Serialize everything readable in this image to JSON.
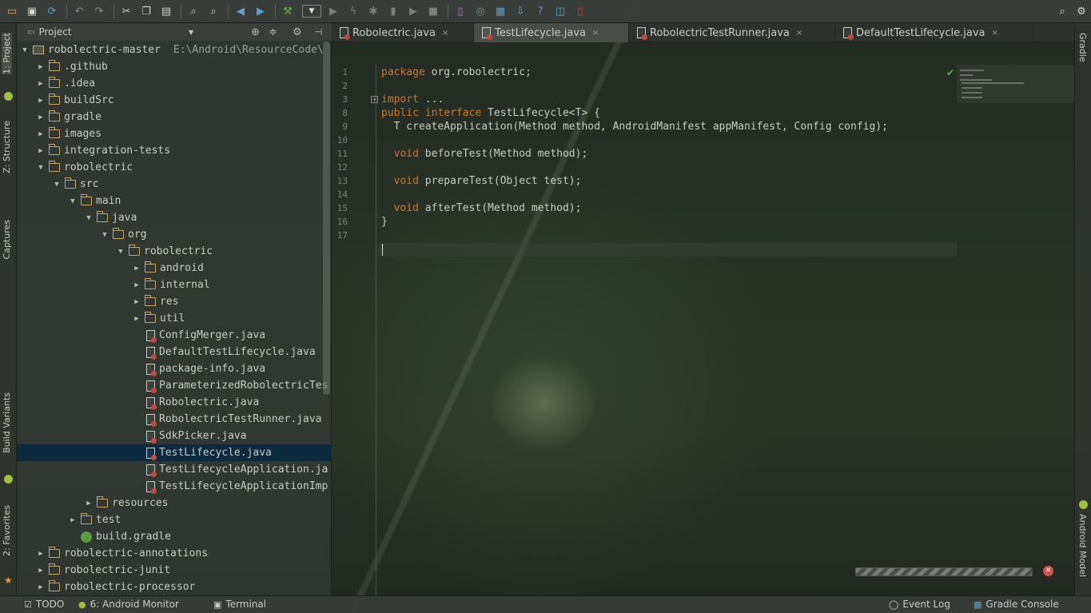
{
  "toolbar": {
    "icons": [
      "open-folder",
      "save",
      "sync",
      "undo",
      "redo",
      "cut",
      "copy",
      "paste",
      "find",
      "find-replace",
      "back",
      "forward",
      "make-project",
      "run-config-dropdown",
      "run",
      "debug",
      "attach-debugger",
      "profile",
      "coverage",
      "stop",
      "avd-manager",
      "sdk-manager",
      "android-device-monitor",
      "project-structure",
      "structure-download",
      "help",
      "translations",
      "device-file"
    ],
    "search_icon": "search-icon"
  },
  "left_stripe": {
    "project": "1: Project",
    "structure": "Z: Structure",
    "captures": "Captures",
    "build_variants": "Build Variants",
    "favorites": "2: Favorites"
  },
  "right_stripe": {
    "gradle": "Gradle",
    "android_model": "Android Model"
  },
  "project_panel": {
    "view_selector": "Project",
    "tree": [
      {
        "label": "robolectric-master",
        "path": "E:\\Android\\ResourceCode\\",
        "type": "module",
        "expanded": true
      },
      {
        "label": ".github",
        "type": "folder"
      },
      {
        "label": ".idea",
        "type": "folder"
      },
      {
        "label": "buildSrc",
        "type": "folder"
      },
      {
        "label": "gradle",
        "type": "folder"
      },
      {
        "label": "images",
        "type": "folder"
      },
      {
        "label": "integration-tests",
        "type": "folder"
      },
      {
        "label": "robolectric",
        "type": "folder",
        "expanded": true
      },
      {
        "label": "src",
        "type": "folder",
        "expanded": true
      },
      {
        "label": "main",
        "type": "folder",
        "expanded": true
      },
      {
        "label": "java",
        "type": "folder",
        "expanded": true
      },
      {
        "label": "org",
        "type": "folder",
        "expanded": true
      },
      {
        "label": "robolectric",
        "type": "folder",
        "expanded": true
      },
      {
        "label": "android",
        "type": "folder"
      },
      {
        "label": "internal",
        "type": "folder"
      },
      {
        "label": "res",
        "type": "folder"
      },
      {
        "label": "util",
        "type": "folder"
      },
      {
        "label": "ConfigMerger.java",
        "type": "java"
      },
      {
        "label": "DefaultTestLifecycle.java",
        "type": "java"
      },
      {
        "label": "package-info.java",
        "type": "java"
      },
      {
        "label": "ParameterizedRobolectricTes",
        "type": "java"
      },
      {
        "label": "Robolectric.java",
        "type": "java"
      },
      {
        "label": "RobolectricTestRunner.java",
        "type": "java"
      },
      {
        "label": "SdkPicker.java",
        "type": "java"
      },
      {
        "label": "TestLifecycle.java",
        "type": "java",
        "selected": true
      },
      {
        "label": "TestLifecycleApplication.ja",
        "type": "java"
      },
      {
        "label": "TestLifecycleApplicationImp",
        "type": "java"
      },
      {
        "label": "resources",
        "type": "folder"
      },
      {
        "label": "test",
        "type": "folder"
      },
      {
        "label": "build.gradle",
        "type": "gradle"
      },
      {
        "label": "robolectric-annotations",
        "type": "folder"
      },
      {
        "label": "robolectric-junit",
        "type": "folder"
      },
      {
        "label": "robolectric-processor",
        "type": "folder"
      }
    ]
  },
  "tabs": [
    {
      "label": "Robolectric.java"
    },
    {
      "label": "TestLifecycle.java",
      "active": true
    },
    {
      "label": "RobolectricTestRunner.java"
    },
    {
      "label": "DefaultTestLifecycle.java"
    }
  ],
  "editor": {
    "line_numbers": [
      "1",
      "2",
      "3",
      "8",
      "9",
      "10",
      "11",
      "12",
      "13",
      "14",
      "15",
      "16",
      "17"
    ],
    "lines": [
      [
        {
          "t": "package",
          "k": true
        },
        {
          "t": " org.robolectric;"
        }
      ],
      [],
      [
        {
          "t": "import",
          "k": true
        },
        {
          "t": " ..."
        }
      ],
      [
        {
          "t": "public interface",
          "k": true
        },
        {
          "t": " TestLifecycle<T> {"
        }
      ],
      [
        {
          "t": "  T createApplication(Method method, AndroidManifest appManifest, Config config);"
        }
      ],
      [],
      [
        {
          "t": "  "
        },
        {
          "t": "void",
          "k": true
        },
        {
          "t": " beforeTest(Method method);"
        }
      ],
      [],
      [
        {
          "t": "  "
        },
        {
          "t": "void",
          "k": true
        },
        {
          "t": " prepareTest(Object test);"
        }
      ],
      [],
      [
        {
          "t": "  "
        },
        {
          "t": "void",
          "k": true
        },
        {
          "t": " afterTest(Method method);"
        }
      ],
      [
        {
          "t": "}"
        }
      ],
      []
    ]
  },
  "status_bar": {
    "todo": "TODO",
    "android_monitor": "6: Android Monitor",
    "terminal": "Terminal",
    "event_log": "Event Log",
    "gradle_console": "Gradle Console"
  }
}
